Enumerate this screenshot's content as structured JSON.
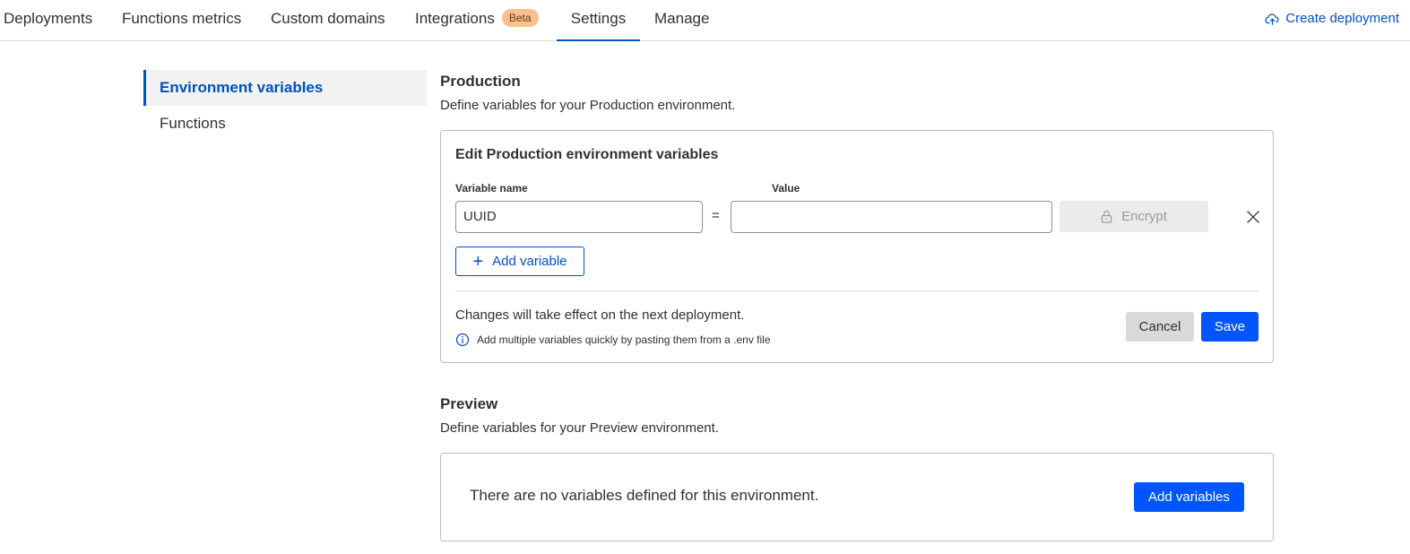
{
  "topnav": {
    "tabs": [
      {
        "label": "Deployments"
      },
      {
        "label": "Functions metrics"
      },
      {
        "label": "Custom domains"
      },
      {
        "label": "Integrations",
        "badge": "Beta"
      },
      {
        "label": "Settings",
        "active": true
      },
      {
        "label": "Manage"
      }
    ],
    "create_deployment": "Create deployment"
  },
  "sidebar": {
    "items": [
      {
        "label": "Environment variables",
        "active": true
      },
      {
        "label": "Functions"
      }
    ]
  },
  "production": {
    "title": "Production",
    "description": "Define variables for your Production environment.",
    "edit": {
      "title": "Edit Production environment variables",
      "variable_name_label": "Variable name",
      "value_label": "Value",
      "variable_name_value": "UUID",
      "value_value": "",
      "equals": "=",
      "encrypt_label": "Encrypt",
      "add_variable_label": "Add variable",
      "add_variable_plus": "+",
      "changes_note": "Changes will take effect on the next deployment.",
      "info_text": "Add multiple variables quickly by pasting them from a .env file",
      "cancel_label": "Cancel",
      "save_label": "Save"
    }
  },
  "preview": {
    "title": "Preview",
    "description": "Define variables for your Preview environment.",
    "empty_message": "There are no variables defined for this environment.",
    "add_variables_label": "Add variables"
  },
  "colors": {
    "accent": "#0051c3",
    "primary_button": "#0055ff",
    "beta_badge": "#fbc08e"
  }
}
